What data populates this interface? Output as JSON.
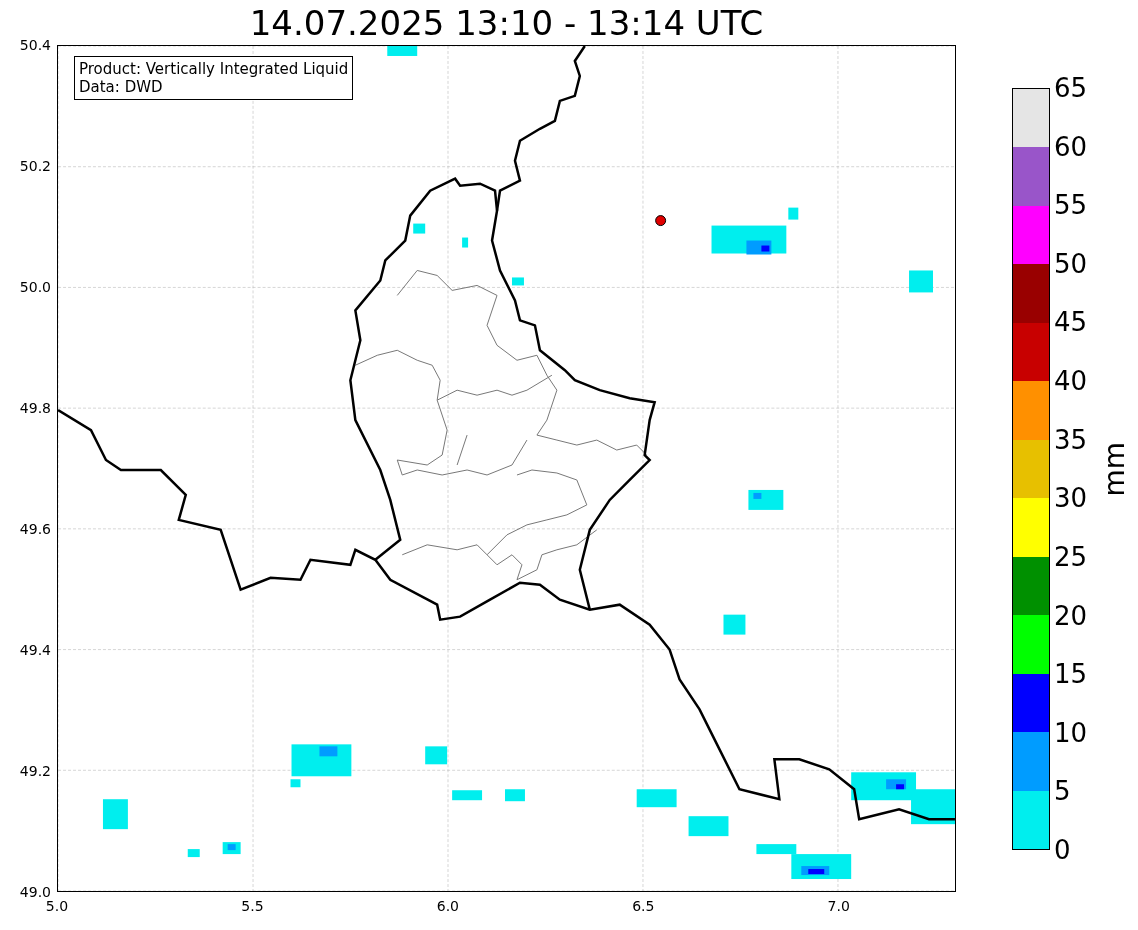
{
  "title": "14.07.2025 13:10 - 13:14 UTC",
  "map": {
    "info_box": [
      "Product: Vertically Integrated Liquid",
      "Data: DWD"
    ],
    "xticks": [
      "5.0",
      "5.5",
      "6.0",
      "6.5",
      "7.0"
    ],
    "yticks": [
      "50.4",
      "50.2",
      "50.0",
      "49.8",
      "49.6",
      "49.4",
      "49.2",
      "49.0"
    ]
  },
  "colorbar": {
    "label": "mm",
    "ticks": [
      "65",
      "60",
      "55",
      "50",
      "45",
      "40",
      "35",
      "30",
      "25",
      "20",
      "15",
      "10",
      "5",
      "0"
    ],
    "bands": [
      {
        "color": "#e5e5e5"
      },
      {
        "color": "#9955c9"
      },
      {
        "color": "#ff00ff"
      },
      {
        "color": "#990000"
      },
      {
        "color": "#c80000"
      },
      {
        "color": "#ff9000"
      },
      {
        "color": "#e7c000"
      },
      {
        "color": "#ffff00"
      },
      {
        "color": "#009000"
      },
      {
        "color": "#00ff00"
      },
      {
        "color": "#0000ff"
      },
      {
        "color": "#009cff"
      },
      {
        "color": "#00eeee"
      }
    ]
  }
}
